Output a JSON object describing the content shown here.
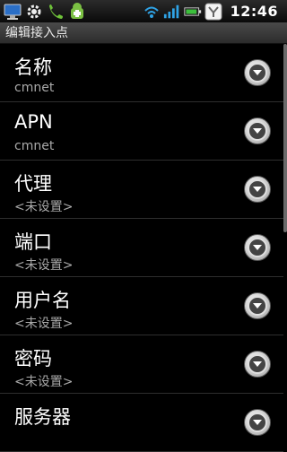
{
  "status_bar": {
    "time": "12:46",
    "icons_left": [
      "monitor-icon",
      "gear-icon",
      "phone-icon",
      "android-update-icon"
    ],
    "icons_right": [
      "wifi-icon",
      "signal-icon",
      "battery-icon",
      "notification-y-icon"
    ]
  },
  "title_bar": {
    "title": "编辑接入点"
  },
  "fields": [
    {
      "title": "名称",
      "summary": "cmnet"
    },
    {
      "title": "APN",
      "summary": "cmnet"
    },
    {
      "title": "代理",
      "summary": "<未设置>"
    },
    {
      "title": "端口",
      "summary": "<未设置>"
    },
    {
      "title": "用户名",
      "summary": "<未设置>"
    },
    {
      "title": "密码",
      "summary": "<未设置>"
    },
    {
      "title": "服务器",
      "summary": ""
    }
  ],
  "colors": {
    "background": "#000000",
    "summary_text": "#a9a9a9",
    "divider": "#2e2e2e"
  }
}
